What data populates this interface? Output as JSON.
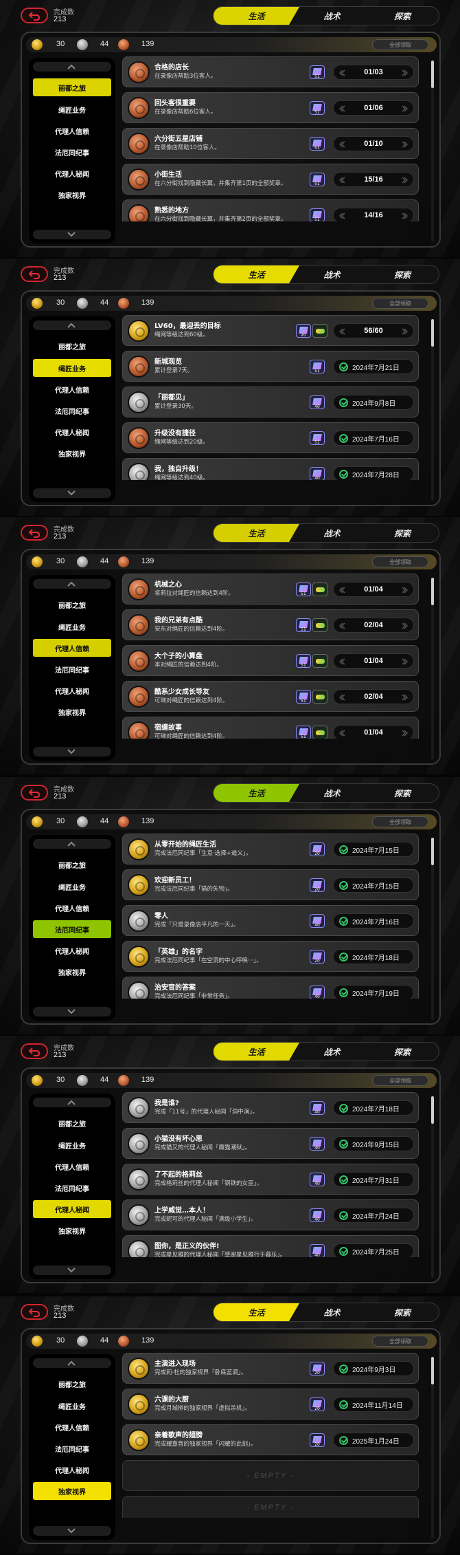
{
  "common": {
    "completion_label": "完成数",
    "completion_value": "213",
    "tabs": [
      "生活",
      "战术",
      "探索"
    ],
    "currency": {
      "gold": "30",
      "silver": "44",
      "bronze": "139"
    },
    "claim_all": "全部领取",
    "sidebar": [
      "丽都之旅",
      "绳匠业务",
      "代理人信赖",
      "法厄同纪事",
      "代理人秘闻",
      "独家视界"
    ],
    "colors": {
      "accent_yellow": "#e4dc00",
      "accent_green": "#9ccd00",
      "accent_bright": "#f6e000",
      "back_red": "#d0262e",
      "check_green": "#35c46a"
    }
  },
  "panels": [
    {
      "active_index": 0,
      "active_color": "#dcd400",
      "rows": [
        {
          "medal": "bronze",
          "title": "合格的店长",
          "desc": "在录像店帮助3位客人。",
          "reward": "51",
          "status": "01/03"
        },
        {
          "medal": "bronze",
          "title": "回头客很重要",
          "desc": "在录像店帮助6位客人。",
          "reward": "51",
          "status": "01/06"
        },
        {
          "medal": "bronze",
          "title": "六分街五星店铺",
          "desc": "在录像店帮助10位客人。",
          "reward": "51",
          "status": "01/10"
        },
        {
          "medal": "bronze",
          "title": "小街生活",
          "desc": "在六分街找到隐藏长翼，并集齐第1页的全部奖章。",
          "reward": "51",
          "status": "15/16"
        },
        {
          "medal": "bronze",
          "title": "熟悉的地方",
          "desc": "在六分街找到隐藏长翼，并集齐第2页的全部奖章。",
          "reward": "51",
          "status": "14/16"
        }
      ]
    },
    {
      "active_index": 1,
      "active_color": "#e6dc00",
      "rows": [
        {
          "medal": "gold",
          "title": "LV60，最迎丢的目标",
          "desc": "绳网等级达到60级。",
          "reward": "20",
          "reward2": true,
          "status": "56/60"
        },
        {
          "medal": "bronze",
          "title": "新城观览",
          "desc": "累计登录7天。",
          "reward": "51",
          "done": "2024年7月21日"
        },
        {
          "medal": "silver",
          "title": "「丽都见」",
          "desc": "累计登录30天。",
          "reward": "40",
          "done": "2024年9月8日"
        },
        {
          "medal": "bronze",
          "title": "升级没有捷径",
          "desc": "绳网等级达到20级。",
          "reward": "51",
          "done": "2024年7月16日"
        },
        {
          "medal": "silver",
          "title": "我，独自升级！",
          "desc": "绳网等级达到40级。",
          "reward": "40",
          "done": "2024年7月28日"
        }
      ]
    },
    {
      "active_index": 2,
      "active_color": "#d6cf00",
      "rows": [
        {
          "medal": "bronze",
          "title": "机械之心",
          "desc": "将莉拉对绳匠的信赖达到4阶。",
          "reward": "51",
          "reward2": true,
          "status": "01/04"
        },
        {
          "medal": "bronze",
          "title": "我的兄弟有点酷",
          "desc": "安东对绳匠的信赖达到4阶。",
          "reward": "51",
          "reward2": true,
          "status": "02/04"
        },
        {
          "medal": "bronze",
          "title": "大个子的小算盘",
          "desc": "本对绳匠的信赖达到4阶。",
          "reward": "51",
          "reward2": true,
          "status": "01/04"
        },
        {
          "medal": "bronze",
          "title": "酷系少女成长导友",
          "desc": "可琳对绳匠的信赖达到4阶。",
          "reward": "51",
          "reward2": true,
          "status": "02/04"
        },
        {
          "medal": "bronze",
          "title": "宿缠故事",
          "desc": "可琳对绳匠的信赖达到4阶。",
          "reward": "51",
          "reward2": true,
          "status": "01/04"
        }
      ]
    },
    {
      "active_index": 3,
      "active_color": "#8fc400",
      "rows": [
        {
          "medal": "gold",
          "title": "从零开始的绳匠生活",
          "desc": "完成法厄同纪事「生意·选择+道义」。",
          "reward": "20",
          "done": "2024年7月15日"
        },
        {
          "medal": "gold",
          "title": "欢迎新员工！",
          "desc": "完成法厄同纪事「猫的失物」。",
          "reward": "20",
          "done": "2024年7月15日"
        },
        {
          "medal": "silver",
          "title": "零人",
          "desc": "完成「只是录像店平凡的一天」。",
          "reward": "40",
          "done": "2024年7月16日"
        },
        {
          "medal": "gold",
          "title": "「英雄」的名字",
          "desc": "完成法厄同纪事「在空洞的中心呼唤···」。",
          "reward": "20",
          "done": "2024年7月18日"
        },
        {
          "medal": "silver",
          "title": "治安官的答案",
          "desc": "完成法厄同纪事「非常任务」。",
          "reward": "40",
          "done": "2024年7月19日"
        }
      ]
    },
    {
      "active_index": 4,
      "active_color": "#e2d900",
      "rows": [
        {
          "medal": "silver",
          "title": "我是谁?",
          "desc": "完成「11号」的代理人秘闻「洞中演」。",
          "reward": "40",
          "done": "2024年7月18日"
        },
        {
          "medal": "silver",
          "title": "小猫没有坏心思",
          "desc": "完成猫又的代理人秘闻「魔猫潮狱」。",
          "reward": "40",
          "done": "2024年9月15日"
        },
        {
          "medal": "silver",
          "title": "了不起的格莉丝",
          "desc": "完成格莉丝的代理人秘闻「钢铁的女巫」。",
          "reward": "40",
          "done": "2024年7月31日"
        },
        {
          "medal": "silver",
          "title": "上学威觉…本人！",
          "desc": "完成妮可的代理人秘闻「满级小学生」。",
          "reward": "40",
          "done": "2024年7月24日"
        },
        {
          "medal": "silver",
          "title": "图你，是正义的伙伴!",
          "desc": "完成星见雅的代理人秘闻「感谢星见雅行于暮乐」。",
          "reward": "40",
          "done": "2024年7月25日"
        }
      ]
    },
    {
      "active_index": 5,
      "active_color": "#f3e000",
      "rows": [
        {
          "medal": "gold",
          "title": "主演进入现场",
          "desc": "完成莉·杜的独家视界「卧底蓝调」。",
          "reward": "20",
          "done": "2024年9月3日"
        },
        {
          "medal": "gold",
          "title": "六课的大厨",
          "desc": "完成月城柳的独家视界「虚拟杀机」。",
          "reward": "20",
          "done": "2024年11月14日"
        },
        {
          "medal": "gold",
          "title": "亲着歌声的翅膀",
          "desc": "完成耀嘉音的独家视界「闪耀的此刻」。",
          "reward": "20",
          "done": "2025年1月24日"
        }
      ],
      "empty_rows": [
        "- EMPTY -",
        "- EMPTY -"
      ]
    }
  ]
}
